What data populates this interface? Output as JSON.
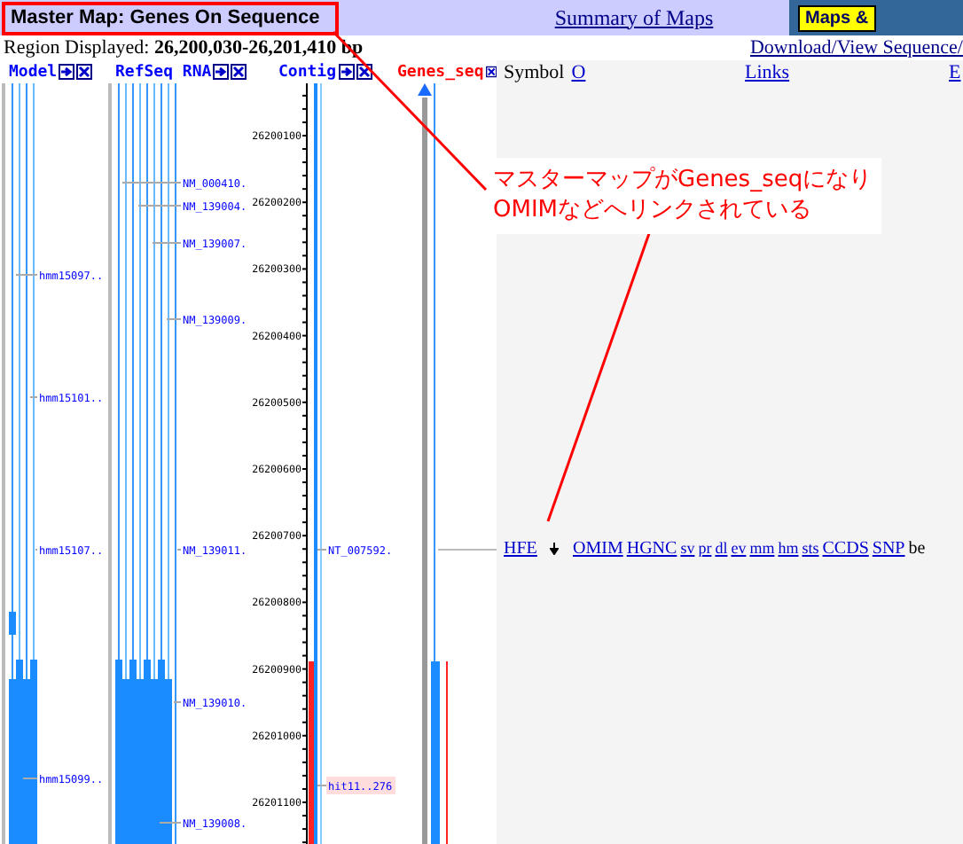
{
  "header": {
    "title": "Master Map: Genes On Sequence",
    "summary_link": "Summary of Maps",
    "menu_button": "Maps &"
  },
  "region": {
    "label": "Region Displayed:",
    "value": "26,200,030-26,201,410 bp"
  },
  "download_link": "Download/View Sequence/",
  "tracks": [
    {
      "title": "Model",
      "kind": "model",
      "master": false,
      "features": [
        {
          "label": "hmm15097..",
          "highlighted": false
        },
        {
          "label": "hmm15101..",
          "highlighted": false
        },
        {
          "label": "hmm15107..",
          "highlighted": false
        },
        {
          "label": "hmm15099..",
          "highlighted": false
        }
      ]
    },
    {
      "title": "RefSeq RNA",
      "kind": "refseq",
      "master": false,
      "features": [
        {
          "label": "NM_000410.",
          "highlighted": false
        },
        {
          "label": "NM_139004.",
          "highlighted": false
        },
        {
          "label": "NM_139007.",
          "highlighted": false
        },
        {
          "label": "NM_139009.",
          "highlighted": false
        },
        {
          "label": "NM_139011.",
          "highlighted": false
        },
        {
          "label": "NM_139010.",
          "highlighted": false
        },
        {
          "label": "NM_139008.",
          "highlighted": false
        }
      ]
    },
    {
      "title": "Contig",
      "kind": "contig",
      "master": false,
      "features": [
        {
          "label": "NT_007592.",
          "highlighted": false
        },
        {
          "label": "hit11..276",
          "highlighted": true
        }
      ]
    },
    {
      "title": "Genes_seq",
      "kind": "genes",
      "master": true
    }
  ],
  "ruler": {
    "ticks": [
      "26200100",
      "26200200",
      "26200300",
      "26200400",
      "26200500",
      "26200600",
      "26200700",
      "26200800",
      "26200900",
      "26201000",
      "26201100"
    ]
  },
  "gene_table": {
    "columns": [
      "Symbol",
      "O",
      "Links",
      "E"
    ],
    "rows": [
      {
        "symbol": "HFE",
        "links": [
          "OMIM",
          "HGNC",
          "sv",
          "pr",
          "dl",
          "ev",
          "mm",
          "hm",
          "sts",
          "CCDS",
          "SNP"
        ],
        "column_4": "be"
      }
    ]
  },
  "annotation": {
    "lines": [
      "マスターマップがGenes_seqになり",
      "OMIMなどへリンクされている"
    ]
  }
}
